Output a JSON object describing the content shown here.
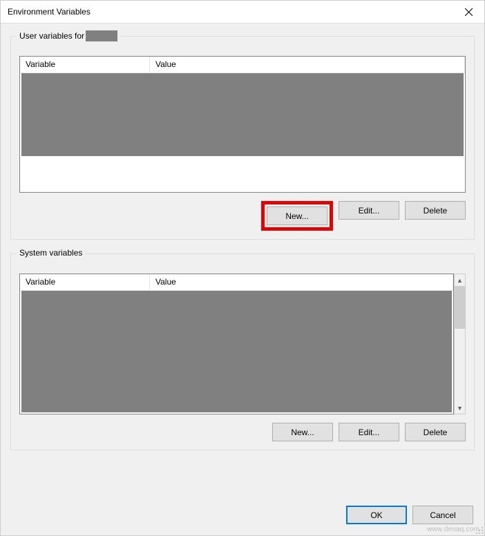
{
  "window": {
    "title": "Environment Variables"
  },
  "user_group": {
    "legend_prefix": "User variables for",
    "headers": {
      "variable": "Variable",
      "value": "Value"
    },
    "buttons": {
      "new": "New...",
      "edit": "Edit...",
      "delete": "Delete"
    }
  },
  "system_group": {
    "legend": "System variables",
    "headers": {
      "variable": "Variable",
      "value": "Value"
    },
    "buttons": {
      "new": "New...",
      "edit": "Edit...",
      "delete": "Delete"
    }
  },
  "footer": {
    "ok": "OK",
    "cancel": "Cancel"
  },
  "watermark": "www.deuaq.com"
}
